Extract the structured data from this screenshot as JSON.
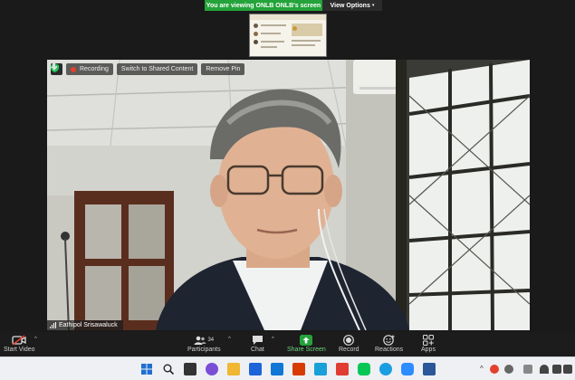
{
  "banner": {
    "text": "You are viewing ONLB ONLB's screen",
    "view_options": "View Options",
    "caret": "▾"
  },
  "video": {
    "recording_label": "Recording",
    "switch_label": "Switch to Shared Content",
    "remove_pin_label": "Remove Pin",
    "participant_name": "Eathipol Srisawaluck"
  },
  "toolbar": {
    "start_video": "Start Video",
    "participants": "Participants",
    "participants_count": "34",
    "chat": "Chat",
    "share_screen": "Share Screen",
    "record": "Record",
    "reactions": "Reactions",
    "apps": "Apps",
    "caret_up": "^"
  },
  "taskbar": {
    "tray_chevron": "^",
    "colors": {
      "windows": "#1f6fd0",
      "zoom": "#2d8cff",
      "share_green": "#24a33a"
    }
  }
}
